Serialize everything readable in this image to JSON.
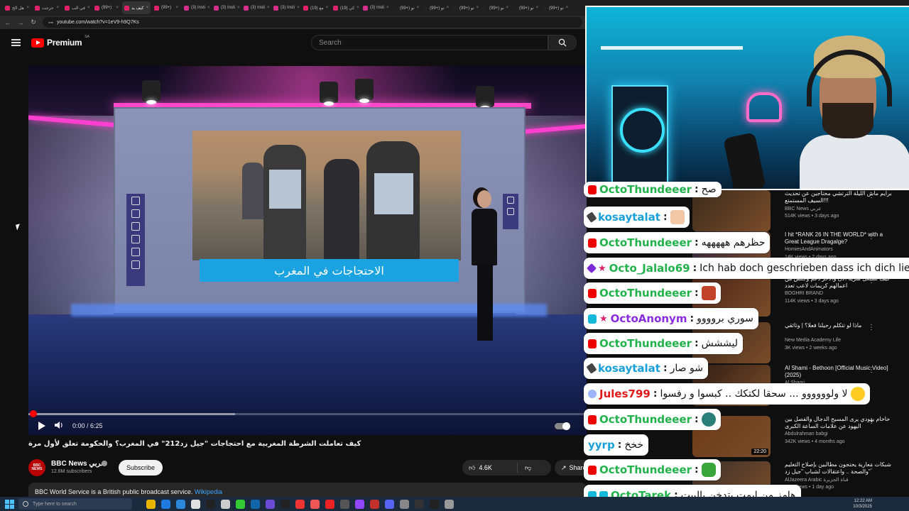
{
  "browser": {
    "tabs": [
      {
        "title": "هل الخ",
        "color": "#e0226a"
      },
      {
        "title": "خرجت",
        "color": "#e0226a"
      },
      {
        "title": "في الب",
        "color": "#e0226a"
      },
      {
        "title": "(99+)",
        "color": "#e0226a"
      },
      {
        "title": "كيف يد",
        "color": "#e0226a"
      },
      {
        "title": "(99+)",
        "color": "#e0226a"
      },
      {
        "title": "(3) Insti",
        "color": "#d22e8a"
      },
      {
        "title": "(3) Insti",
        "color": "#d22e8a"
      },
      {
        "title": "(3) Insti",
        "color": "#d22e8a"
      },
      {
        "title": "(3) Insti",
        "color": "#d22e8a"
      },
      {
        "title": "(19) مع",
        "color": "#e0226a"
      },
      {
        "title": "(19) كي",
        "color": "#e0226a"
      },
      {
        "title": "(3) Insti",
        "color": "#d22e8a"
      },
      {
        "title": "(99+) تو",
        "color": "#222"
      },
      {
        "title": "(99+) تو",
        "color": "#222"
      },
      {
        "title": "(99+) تو",
        "color": "#222"
      },
      {
        "title": "(99+) تو",
        "color": "#222"
      },
      {
        "title": "(99+) تو",
        "color": "#222"
      },
      {
        "title": "(99+) تو",
        "color": "#222"
      }
    ],
    "url": "youtube.com/watch?v=1eV9-h9Q7Ks"
  },
  "youtube": {
    "logo_text": "Premium",
    "logo_country": "SA",
    "search_placeholder": "Search"
  },
  "video": {
    "caption": "الاحتجاجات في المغرب",
    "time": "0:00 / 6:25",
    "progress_fraction": 0.0,
    "buffered_fraction": 0.37,
    "title": "كيف تعاملت الشرطة المغربية مع احتجاجات \"جيل زد212\" في المغرب؟ والحكومة تعلق لأول مرة",
    "channel": "BBC News عربي",
    "channel_avatar": "BBC NEWS",
    "subscribers": "12.6M subscribers",
    "subscribe_label": "Subscribe",
    "likes": "4.6K",
    "share_label": "Share",
    "description": "BBC World Service is a British public broadcast service.",
    "description_link": "Wikipedia"
  },
  "recommendations": [
    {
      "title": "برايم ماش الليلة الترتشي محتاجين عن تحديث السيف المستمتع!!!",
      "channel": "BBC News عربي",
      "views": "514K views • 3 days ago",
      "duration": "",
      "thumb_color": "#3b2b1c"
    },
    {
      "title": "I hit *RANK 26 IN THE WORLD* with a Great League Dragalge?",
      "channel": "HomiesAndAnimators",
      "views": "14K views • 2 days ago",
      "duration": "",
      "thumb_color": "#2c2440"
    },
    {
      "title": "كيف تشتغل سرية الآن والآخر دعم وجلس من اعمالهم كريمات لاعب تعدد",
      "channel": "BOGHRI BRAND",
      "views": "114K views • 3 days ago",
      "duration": "",
      "thumb_color": "#4a2316"
    },
    {
      "title": "ماذا لو تتكلم رحيلنا فعلا؟ | وثائقي",
      "channel": "New Media Academy Life",
      "views": "3K views • 2 weeks ago",
      "duration": "",
      "thumb_color": "#3a2618"
    },
    {
      "title": "Al Shami - Bethoon [Official Music Video] (2025)",
      "channel": "Al Shami",
      "views": "",
      "duration": "",
      "thumb_color": "#2e1c14"
    },
    {
      "title": "حاخام يهودي يرى المسيح الدجال والفصل بين اليهود عن علامات الساعة الكبرى",
      "channel": "Abdulrahman babgi",
      "views": "342K views • 4 months ago",
      "duration": "22:20",
      "thumb_color": "#6b3a1a"
    },
    {
      "title": "شبكات معارية يحتجون مطالبين بإصلاح التعليم والصحة .. واعتقالات لشباب \"جيل زد\"",
      "channel": "AlJazeera Arabic قناة الجزيرة",
      "views": "20K views • 1 day ago",
      "duration": "",
      "thumb_color": "#3a2f2a"
    }
  ],
  "chat": [
    {
      "badges": [
        "yt"
      ],
      "name": "OctoThundeeer",
      "name_color": "#22b24c",
      "text": "صح",
      "emote": ""
    },
    {
      "badges": [
        "pen"
      ],
      "name": "kosaytalat",
      "name_color": "#1aa0d8",
      "text": "",
      "emote": "face1"
    },
    {
      "badges": [
        "yt"
      ],
      "name": "OctoThundeeer",
      "name_color": "#22b24c",
      "text": "حظرهم هههههه",
      "emote": ""
    },
    {
      "badges": [
        "cube",
        "star"
      ],
      "name": "Octo_Jalalo69",
      "name_color": "#22b24c",
      "text": "Ich hab doch geschrieben dass ich dich liebe meine",
      "emote": ""
    },
    {
      "badges": [
        "yt"
      ],
      "name": "OctoThundeeer",
      "name_color": "#22b24c",
      "text": "",
      "emote": "face2"
    },
    {
      "badges": [
        "sq",
        "star"
      ],
      "name": "OctoAnonym",
      "name_color": "#8a2be2",
      "text": "سوري بروووو",
      "emote": ""
    },
    {
      "badges": [
        "yt"
      ],
      "name": "OctoThundeeer",
      "name_color": "#22b24c",
      "text": "ليششش",
      "emote": ""
    },
    {
      "badges": [
        "pen"
      ],
      "name": "kosaytalat",
      "name_color": "#1aa0d8",
      "text": "شو صار",
      "emote": ""
    },
    {
      "badges": [
        "orb"
      ],
      "name": "Jules799",
      "name_color": "#e01a1a",
      "text": "لا ولوووووو ... سحقا لكتكك .. كبسوا و رفسوا",
      "emote": "wow"
    },
    {
      "badges": [
        "yt"
      ],
      "name": "OctoThundeeer",
      "name_color": "#22b24c",
      "text": "",
      "emote": "bubble"
    },
    {
      "badges": [],
      "name": "yyrp",
      "name_color": "#1aa0d8",
      "text": "خخخ",
      "emote": ""
    },
    {
      "badges": [
        "yt"
      ],
      "name": "OctoThundeeer",
      "name_color": "#22b24c",
      "text": "",
      "emote": "hand"
    },
    {
      "badges": [
        "sq",
        "sq"
      ],
      "name": "OctoTarek",
      "name_color": "#22b24c",
      "text": "هامز من ايمت يتدخن بالبيت",
      "emote": ""
    }
  ],
  "taskbar": {
    "search_placeholder": "Type here to search",
    "time": "12:22 AM",
    "date": "10/3/2025"
  }
}
